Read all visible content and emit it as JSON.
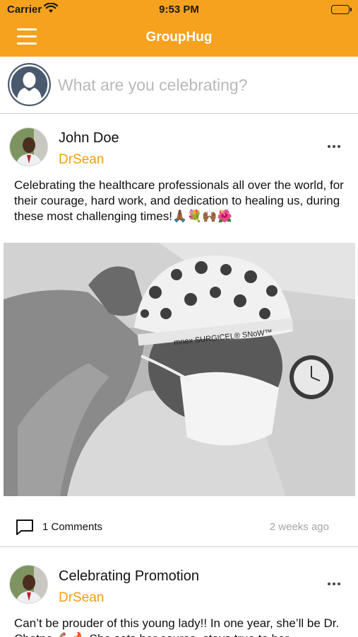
{
  "status_bar": {
    "carrier": "Carrier",
    "time": "9:53 PM",
    "wifi_icon": "wifi-icon",
    "battery_icon": "battery-icon"
  },
  "nav": {
    "title": "GroupHug",
    "menu_icon": "hamburger-menu-icon"
  },
  "composer": {
    "placeholder": "What are you celebrating?"
  },
  "posts": [
    {
      "name": "John Doe",
      "handle": "DrSean",
      "text": "Celebrating the healthcare professionals all over the world, for their courage, hard work, and dedication to healing us, during these most challenging times!🙏🏾💐🙌🏾🌺",
      "comments_label": "1 Comments",
      "time": "2 weeks ago",
      "photo_cap_text": "mnex   SURGICEL® SNoW™"
    },
    {
      "name": "Celebrating Promotion",
      "handle": "DrSean",
      "text": "Can’t be prouder of this young lady!! In one year, she’ll be Dr. Chetna 💪🏽🔥 She sets her course, stays true to her"
    }
  ],
  "colors": {
    "accent": "#f6a21f",
    "handle": "#f29d13",
    "muted": "#a5a5a5",
    "divider": "#cfcfcf"
  }
}
